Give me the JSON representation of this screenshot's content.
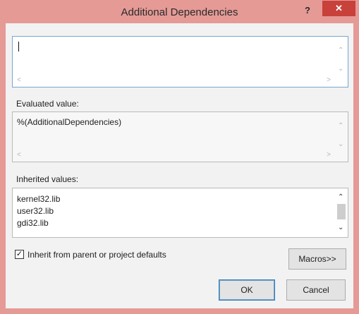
{
  "window": {
    "title": "Additional Dependencies",
    "help_label": "?",
    "close_label": "✕"
  },
  "editor": {
    "value": ""
  },
  "evaluated": {
    "label": "Evaluated value:",
    "value": "%(AdditionalDependencies)"
  },
  "inherited": {
    "label": "Inherited values:",
    "items": [
      "kernel32.lib",
      "user32.lib",
      "gdi32.lib"
    ]
  },
  "inherit_checkbox": {
    "label": "Inherit from parent or project defaults",
    "checked": true,
    "mark": "✓"
  },
  "buttons": {
    "macros": "Macros>>",
    "ok": "OK",
    "cancel": "Cancel"
  },
  "icons": {
    "scroll_up": "up-arrow",
    "scroll_down": "down-arrow",
    "scroll_left": "left-arrow",
    "scroll_right": "right-arrow"
  },
  "colors": {
    "title_bar": "#e59a96",
    "close_button": "#c8413a",
    "dialog_bg": "#f2f2f2",
    "focus_border": "#7aa6cf"
  }
}
